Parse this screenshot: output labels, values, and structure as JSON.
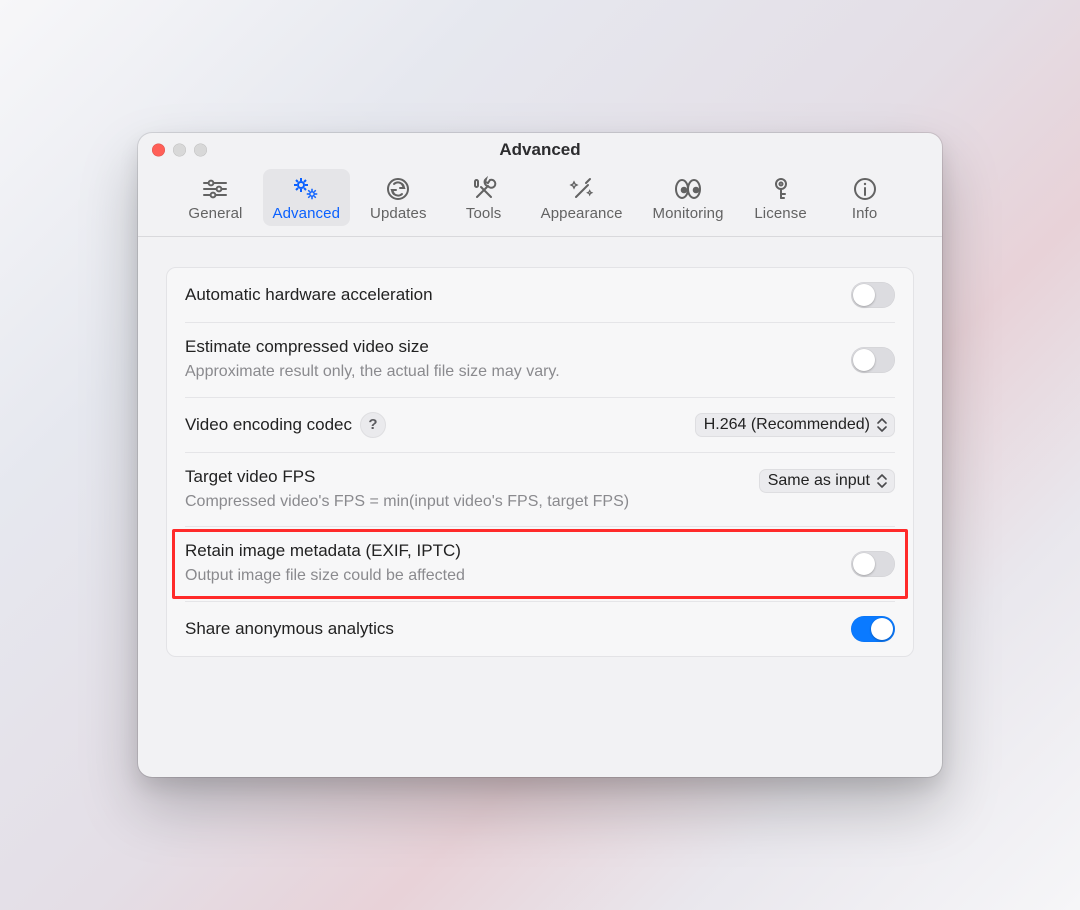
{
  "window": {
    "title": "Advanced"
  },
  "toolbar": {
    "items": [
      {
        "id": "general",
        "label": "General"
      },
      {
        "id": "advanced",
        "label": "Advanced"
      },
      {
        "id": "updates",
        "label": "Updates"
      },
      {
        "id": "tools",
        "label": "Tools"
      },
      {
        "id": "appearance",
        "label": "Appearance"
      },
      {
        "id": "monitoring",
        "label": "Monitoring"
      },
      {
        "id": "license",
        "label": "License"
      },
      {
        "id": "info",
        "label": "Info"
      }
    ],
    "active": "advanced"
  },
  "settings": {
    "hw_accel": {
      "title": "Automatic hardware acceleration",
      "on": false
    },
    "estimate_size": {
      "title": "Estimate compressed video size",
      "desc": "Approximate result only, the actual file size may vary.",
      "on": false
    },
    "codec": {
      "title": "Video encoding codec",
      "value": "H.264 (Recommended)"
    },
    "fps": {
      "title": "Target video FPS",
      "value": "Same as input",
      "desc": "Compressed video's FPS = min(input video's FPS, target FPS)"
    },
    "metadata": {
      "title": "Retain image metadata (EXIF, IPTC)",
      "desc": "Output image file size could be affected",
      "on": false,
      "highlighted": true
    },
    "analytics": {
      "title": "Share anonymous analytics",
      "on": true
    }
  },
  "help_glyph": "?"
}
